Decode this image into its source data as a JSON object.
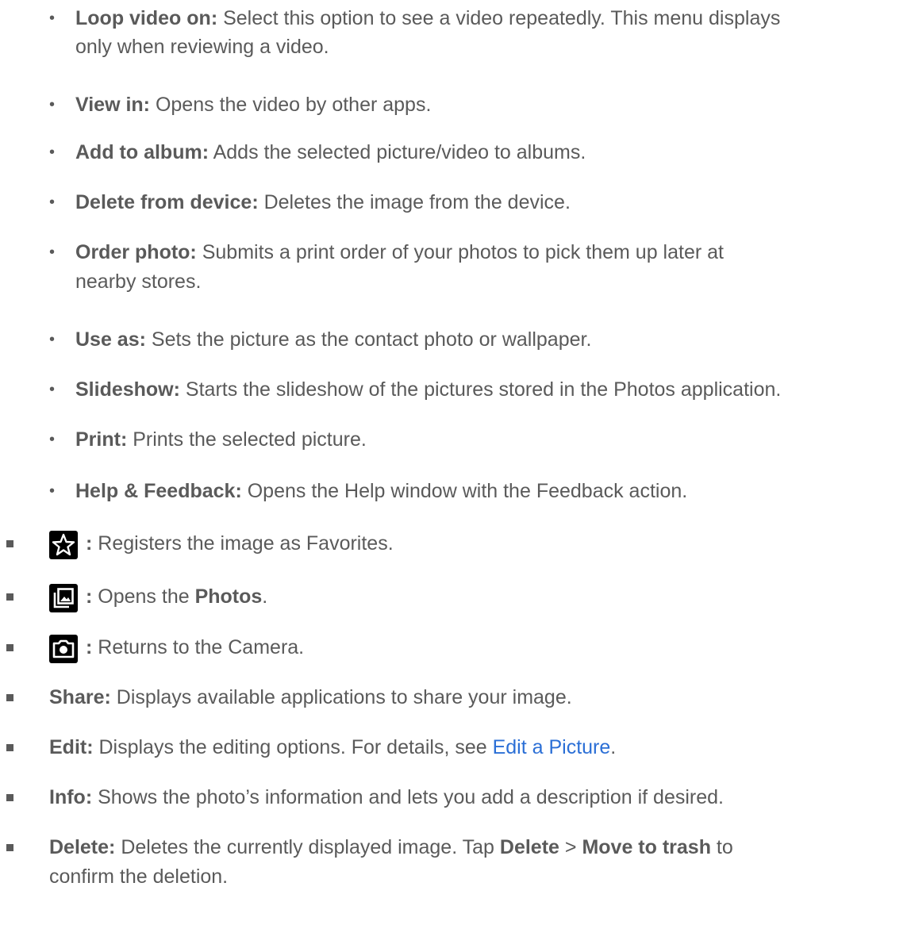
{
  "level1_items": [
    {
      "term": "Loop video on:",
      "text": " Select this option to see a video repeatedly. This menu displays",
      "cont": "only when reviewing a video."
    },
    {
      "term": "View in:",
      "text": " Opens the video by other apps."
    },
    {
      "term": "Add to album:",
      "text": " Adds the selected picture/video to albums."
    },
    {
      "term": "Delete from device:",
      "text": " Deletes the image from the device."
    },
    {
      "term": "Order photo:",
      "text": " Submits a print order of your photos to pick them up later at",
      "cont": "nearby stores."
    },
    {
      "term": "Use as:",
      "text": " Sets the picture as the contact photo or wallpaper."
    },
    {
      "term": "Slideshow:",
      "text": " Starts the slideshow of the pictures stored in the Photos application."
    },
    {
      "term": "Print:",
      "text": " Prints the selected picture."
    },
    {
      "term": "Help & Feedback:",
      "text": " Opens the Help window with the Feedback action."
    }
  ],
  "icon_items": [
    {
      "icon": "star-icon",
      "colon": ":",
      "text": " Registers the image as Favorites."
    },
    {
      "icon": "photos-icon",
      "colon": ":",
      "text": " Opens the ",
      "bold": "Photos",
      "tail": "."
    },
    {
      "icon": "camera-icon",
      "colon": ":",
      "text": " Returns to the Camera."
    }
  ],
  "level2_items": [
    {
      "term": "Share:",
      "text": " Displays available applications to share your image."
    },
    {
      "term": "Edit:",
      "text": " Displays the editing options. For details, see ",
      "link": "Edit a Picture",
      "tail": "."
    },
    {
      "term": "Info:",
      "text": " Shows the photo’s information and lets you add a description if desired."
    },
    {
      "term": "Delete:",
      "text": " Deletes the currently displayed image. Tap ",
      "b1": "Delete",
      "mid": " > ",
      "b2": "Move to trash",
      "tail": " to",
      "cont": "confirm the deletion."
    }
  ],
  "bullet_glyph": "•",
  "colors": {
    "text": "#5a5a5a",
    "link": "#2b6fd6",
    "icon_bg": "#000000"
  }
}
